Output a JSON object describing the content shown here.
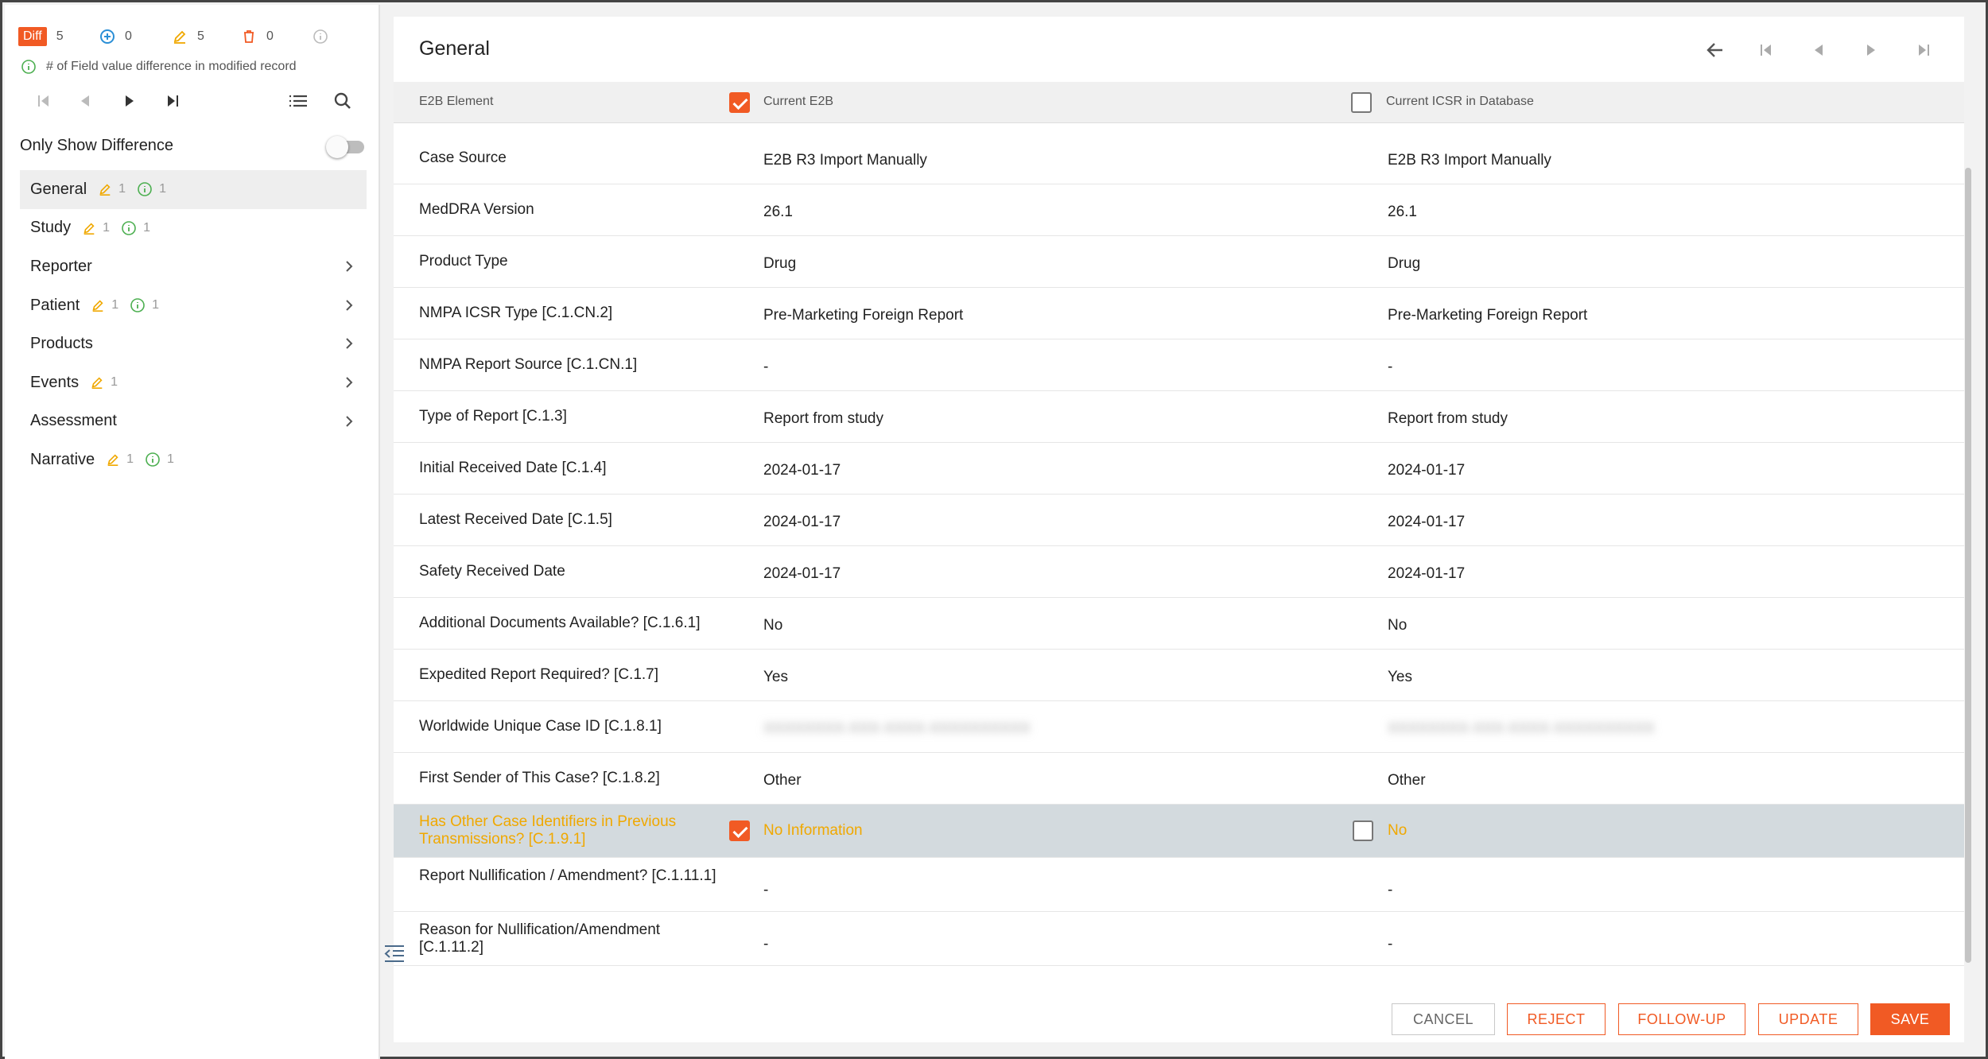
{
  "sidebar": {
    "counts": {
      "diff_label": "Diff",
      "diff": "5",
      "added": "0",
      "modified": "5",
      "deleted": "0"
    },
    "info_text": "# of Field value difference in modified record",
    "only_show_difference": "Only Show Difference",
    "only_show_difference_on": false,
    "sections": [
      {
        "label": "General",
        "modified": "1",
        "info": "1",
        "chevron": false,
        "active": true
      },
      {
        "label": "Study",
        "modified": "1",
        "info": "1",
        "chevron": false,
        "active": false
      },
      {
        "label": "Reporter",
        "modified": "",
        "info": "",
        "chevron": true,
        "active": false
      },
      {
        "label": "Patient",
        "modified": "1",
        "info": "1",
        "chevron": true,
        "active": false
      },
      {
        "label": "Products",
        "modified": "",
        "info": "",
        "chevron": true,
        "active": false
      },
      {
        "label": "Events",
        "modified": "1",
        "info": "",
        "chevron": true,
        "active": false
      },
      {
        "label": "Assessment",
        "modified": "",
        "info": "",
        "chevron": true,
        "active": false
      },
      {
        "label": "Narrative",
        "modified": "1",
        "info": "1",
        "chevron": false,
        "active": false
      }
    ]
  },
  "main": {
    "title": "General",
    "header": {
      "col1": "E2B Element",
      "col2": "Current E2B",
      "col3": "Current ICSR in Database",
      "col2_checked": true,
      "col3_checked": false
    },
    "rows": [
      {
        "label": "Case Source",
        "e2b": "E2B R3 Import Manually",
        "db": "E2B R3 Import Manually"
      },
      {
        "label": "MedDRA Version",
        "e2b": "26.1",
        "db": "26.1"
      },
      {
        "label": "Product Type",
        "e2b": "Drug",
        "db": "Drug"
      },
      {
        "label": "NMPA ICSR Type [C.1.CN.2]",
        "e2b": "Pre-Marketing Foreign Report",
        "db": "Pre-Marketing Foreign Report"
      },
      {
        "label": "NMPA Report Source [C.1.CN.1]",
        "e2b": "-",
        "db": "-"
      },
      {
        "label": "Type of Report [C.1.3]",
        "e2b": "Report from study",
        "db": "Report from study"
      },
      {
        "label": "Initial Received Date [C.1.4]",
        "e2b": "2024-01-17",
        "db": "2024-01-17"
      },
      {
        "label": "Latest Received Date [C.1.5]",
        "e2b": "2024-01-17",
        "db": "2024-01-17"
      },
      {
        "label": "Safety Received Date",
        "e2b": "2024-01-17",
        "db": "2024-01-17"
      },
      {
        "label": "Additional Documents Available? [C.1.6.1]",
        "e2b": "No",
        "db": "No"
      },
      {
        "label": "Expedited Report Required? [C.1.7]",
        "e2b": "Yes",
        "db": "Yes"
      },
      {
        "label": "Worldwide Unique Case ID [C.1.8.1]",
        "e2b": "XXXXXXXX-XXX-XXXX-XXXXXXXXXX",
        "db": "XXXXXXXX-XXX-XXXX-XXXXXXXXXX"
      },
      {
        "label": "First Sender of This Case? [C.1.8.2]",
        "e2b": "Other",
        "db": "Other"
      }
    ],
    "diff_row": {
      "label": "Has Other Case Identifiers in Previous Transmissions? [C.1.9.1]",
      "e2b": "No Information",
      "db": "No",
      "e2b_checked": true,
      "db_checked": false
    },
    "tail_rows": [
      {
        "label": "Report Nullification / Amendment? [C.1.11.1]",
        "e2b": "-",
        "db": "-"
      },
      {
        "label": "Reason for Nullification/Amendment [C.1.11.2]",
        "e2b": "-",
        "db": "-"
      }
    ]
  },
  "footer": {
    "cancel": "CANCEL",
    "reject": "REJECT",
    "follow_up": "FOLLOW-UP",
    "update": "UPDATE",
    "save": "SAVE"
  },
  "colors": {
    "accent": "#f15a24",
    "modified": "#f0a800",
    "added": "#2b8fd6",
    "info": "#4caf50"
  },
  "icons": [
    "plus-circle-icon",
    "pencil-icon",
    "trash-icon",
    "info-icon",
    "first-page-icon",
    "previous-icon",
    "play-icon",
    "last-page-icon",
    "list-icon",
    "search-icon",
    "chevron-right-icon",
    "arrow-left-icon",
    "collapse-panel-icon"
  ]
}
